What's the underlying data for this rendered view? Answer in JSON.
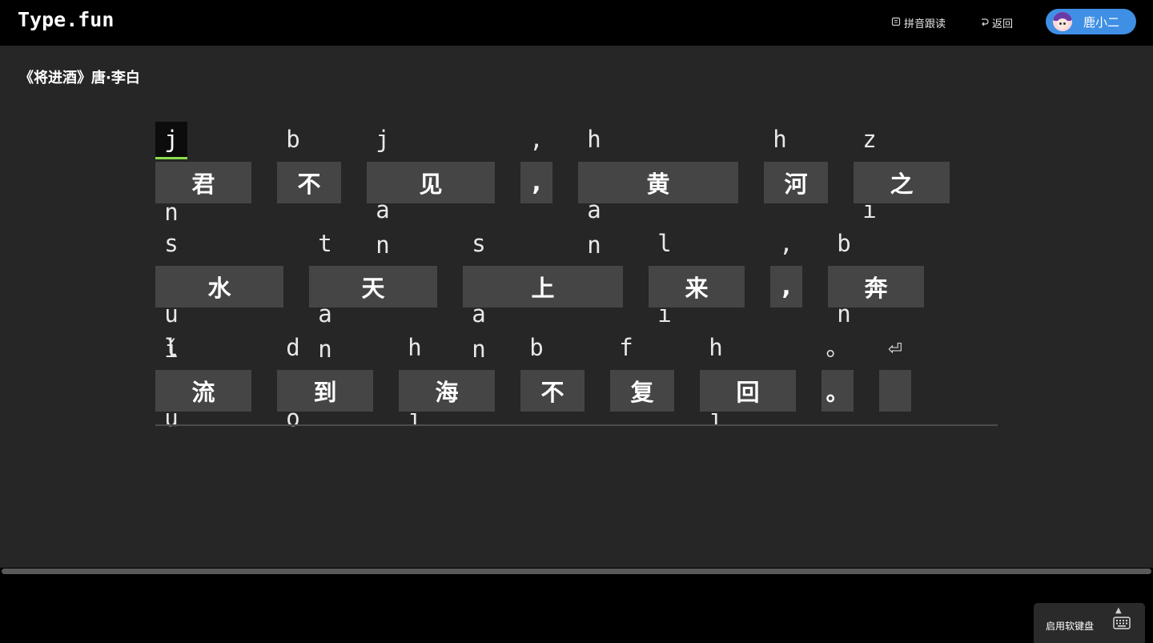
{
  "app": {
    "brand": "Type.fun"
  },
  "header": {
    "pinyin_follow": {
      "icon": "book-icon",
      "label": "拼音跟读"
    },
    "back": {
      "icon": "return-icon",
      "label": "返回"
    },
    "user": {
      "name": "鹿小二",
      "avatar": "avatar-girl"
    }
  },
  "poem": {
    "title": "《将进酒》唐·李白"
  },
  "lines": [
    {
      "syllables": [
        {
          "letters": [
            "j",
            "ū",
            "n"
          ],
          "hanzi": "君"
        },
        {
          "letters": [
            "b",
            "ú"
          ],
          "hanzi": "不"
        },
        {
          "letters": [
            "j",
            "i",
            "à",
            "n"
          ],
          "hanzi": "见"
        },
        {
          "letters": [
            ","
          ],
          "hanzi": ","
        },
        {
          "letters": [
            "h",
            "u",
            "á",
            "n",
            "g"
          ],
          "hanzi": "黄"
        },
        {
          "letters": [
            "h",
            "é"
          ],
          "hanzi": "河"
        },
        {
          "letters": [
            "z",
            "h",
            "ī"
          ],
          "hanzi": "之"
        }
      ]
    },
    {
      "syllables": [
        {
          "letters": [
            "s",
            "h",
            "u",
            "ǐ"
          ],
          "hanzi": "水"
        },
        {
          "letters": [
            "t",
            "i",
            "ā",
            "n"
          ],
          "hanzi": "天"
        },
        {
          "letters": [
            "s",
            "h",
            "à",
            "n",
            "g"
          ],
          "hanzi": "上"
        },
        {
          "letters": [
            "l",
            "á",
            "i"
          ],
          "hanzi": "来"
        },
        {
          "letters": [
            ","
          ],
          "hanzi": ","
        },
        {
          "letters": [
            "b",
            "ē",
            "n"
          ],
          "hanzi": "奔"
        }
      ]
    },
    {
      "syllables": [
        {
          "letters": [
            "l",
            "i",
            "ú"
          ],
          "hanzi": "流"
        },
        {
          "letters": [
            "d",
            "à",
            "o"
          ],
          "hanzi": "到"
        },
        {
          "letters": [
            "h",
            "ǎ",
            "i"
          ],
          "hanzi": "海"
        },
        {
          "letters": [
            "b",
            "ú"
          ],
          "hanzi": "不"
        },
        {
          "letters": [
            "f",
            "ù"
          ],
          "hanzi": "复"
        },
        {
          "letters": [
            "h",
            "u",
            "í"
          ],
          "hanzi": "回"
        },
        {
          "letters": [
            "。"
          ],
          "hanzi": "。"
        },
        {
          "letters": [
            "⏎"
          ],
          "hanzi": ""
        }
      ]
    }
  ],
  "cursor": {
    "line": 1,
    "syllable": 1,
    "letter": 1
  },
  "footer": {
    "soft_keyboard": {
      "label": "启用软键盘",
      "icon": "keyboard-icon",
      "caret_icon": "caret-up-icon"
    }
  },
  "colors": {
    "accent": "#3f8fe5",
    "cursor_underline": "#8dde4c",
    "box": "#454545",
    "main_bg": "#262626"
  }
}
